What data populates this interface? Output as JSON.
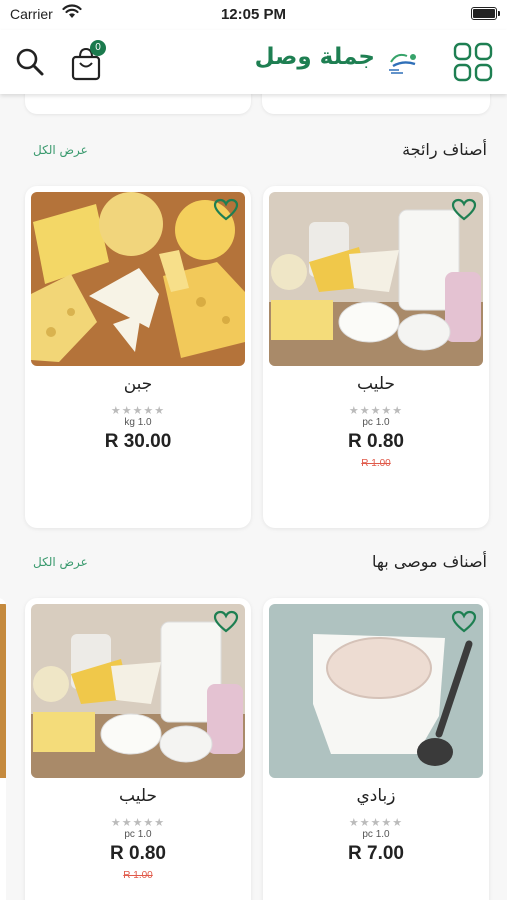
{
  "status_bar": {
    "carrier": "Carrier",
    "time": "12:05 PM"
  },
  "header": {
    "title": "جملة وصل",
    "cart_count": "0",
    "icons": {
      "search": "search-icon",
      "cart": "shopping-bag-icon",
      "menu": "grid-menu-icon",
      "logo": "brand-logo-icon"
    }
  },
  "sections": [
    {
      "title": "أصناف رائجة",
      "view_all": "عرض الكل",
      "products": [
        {
          "name": "حليب",
          "rating": 0,
          "unit": "pc 1.0",
          "price": "R 0.80",
          "old_price": "R 1.00",
          "image": "dairy-products-photo"
        },
        {
          "name": "جبن",
          "rating": 0,
          "unit": "kg 1.0",
          "price": "R 30.00",
          "old_price": "",
          "image": "cheese-board-photo"
        }
      ]
    },
    {
      "title": "أصناف موصى بها",
      "view_all": "عرض الكل",
      "products": [
        {
          "name": "زبادي",
          "rating": 0,
          "unit": "pc 1.0",
          "price": "R 7.00",
          "old_price": "",
          "image": "yogurt-cup-photo"
        },
        {
          "name": "حليب",
          "rating": 0,
          "unit": "pc 1.0",
          "price": "R 0.80",
          "old_price": "R 1.00",
          "image": "dairy-products-photo"
        }
      ]
    }
  ],
  "colors": {
    "brand_green": "#1e7f52",
    "accent_green": "#3a9a6e",
    "sale_red": "#e05a4a",
    "background": "#f7f7f7"
  }
}
